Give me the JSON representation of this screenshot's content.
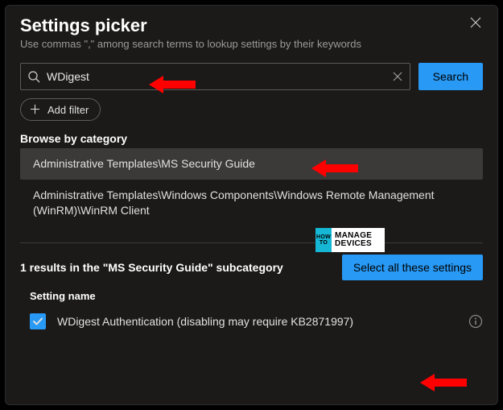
{
  "header": {
    "title": "Settings picker",
    "subtitle": "Use commas \",\" among search terms to lookup settings by their keywords"
  },
  "search": {
    "value": "WDigest",
    "button_label": "Search"
  },
  "filter": {
    "add_label": "Add filter"
  },
  "browse": {
    "heading": "Browse by category",
    "items": [
      "Administrative Templates\\MS Security Guide",
      "Administrative Templates\\Windows Components\\Windows Remote Management (WinRM)\\WinRM Client"
    ]
  },
  "results": {
    "summary": "1 results in the \"MS Security Guide\" subcategory",
    "select_all_label": "Select all these settings",
    "column_header": "Setting name",
    "rows": [
      {
        "label": "WDigest Authentication (disabling may require KB2871997)",
        "checked": true
      }
    ]
  },
  "watermark": {
    "left_top": "HOW",
    "left_bot": "TO",
    "r1": "MANAGE",
    "r2": "DEVICES"
  },
  "colors": {
    "accent": "#2899f5",
    "panel": "#1b1a19",
    "hover": "#3b3a39",
    "callout": "#ff0000"
  }
}
